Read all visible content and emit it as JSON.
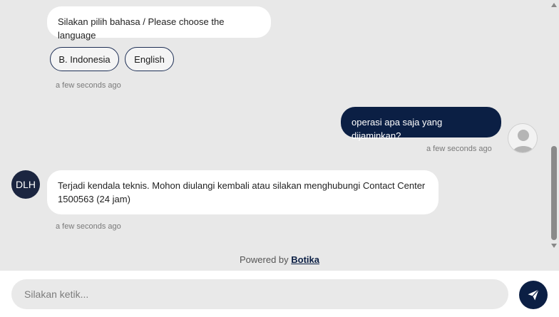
{
  "messages": {
    "bot_language_prompt": "Silakan pilih bahasa / Please choose the language",
    "quick_replies": [
      "B. Indonesia",
      "English"
    ],
    "timestamp_1": "a few seconds ago",
    "user_message": "operasi apa saja yang dijaminkan?",
    "timestamp_2": "a few seconds ago",
    "bot_error": "Terjadi kendala teknis. Mohon diulangi kembali atau silakan menghubungi Contact Center 1500563 (24 jam)",
    "timestamp_3": "a few seconds ago"
  },
  "bot_avatar_initials": "DLH",
  "footer": {
    "powered_prefix": "Powered by",
    "powered_brand": "Botika"
  },
  "composer": {
    "placeholder": "Silakan ketik..."
  },
  "icons": {
    "send": "paper-plane-icon",
    "user_avatar": "default-user-icon"
  },
  "colors": {
    "primary": "#0b1f44",
    "background": "#e8e8e8",
    "bubble_bot": "#ffffff"
  }
}
